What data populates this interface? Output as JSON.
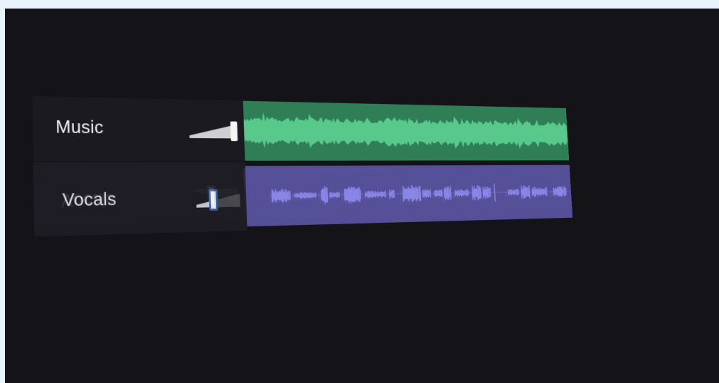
{
  "tracks": [
    {
      "name": "Music",
      "volume": 1.0,
      "color": "#2f7e56",
      "wave_color": "#58c98b",
      "selected": false
    },
    {
      "name": "Vocals",
      "volume": 0.25,
      "color": "#554f98",
      "wave_color": "#8a86e8",
      "selected": true
    }
  ],
  "colors": {
    "background": "#141318",
    "label_panel": "#1b1a20",
    "track_text": "#f2f2f4",
    "selection_border": "#3b5fa0"
  }
}
